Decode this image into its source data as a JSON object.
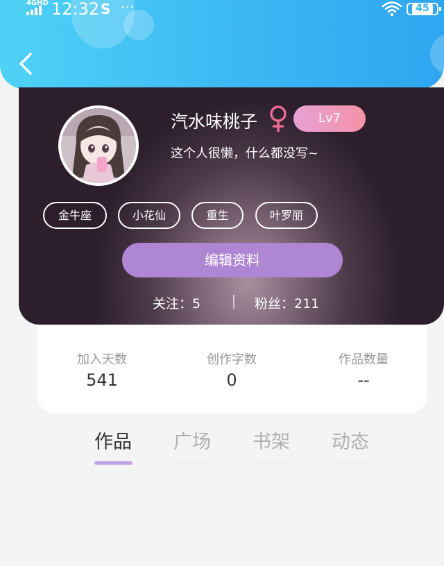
{
  "status_bar": {
    "network": "4GHD",
    "time": "12:32",
    "app_glyph": "S",
    "more": "···",
    "battery": "45"
  },
  "profile": {
    "name": "汽水味桃子",
    "gender_symbol": "♀",
    "level": "Lv7",
    "bio": "这个人很懒，什么都没写~",
    "tags": [
      "金牛座",
      "小花仙",
      "重生",
      "叶罗丽"
    ],
    "edit_label": "编辑资料",
    "following": "关注：5",
    "fans": "粉丝：211"
  },
  "stats": [
    {
      "label": "加入天数",
      "value": "541"
    },
    {
      "label": "创作字数",
      "value": "0"
    },
    {
      "label": "作品数量",
      "value": "--"
    }
  ],
  "tabs": [
    {
      "label": "作品",
      "active": true
    },
    {
      "label": "广场",
      "active": false
    },
    {
      "label": "书架",
      "active": false
    },
    {
      "label": "动态",
      "active": false
    }
  ],
  "colors": {
    "header": "#3cb7f2",
    "accent": "#ae86d4",
    "level_badge": "#f592a6",
    "gender": "#f06a96"
  },
  "icons": [
    "back-arrow-icon",
    "female-icon",
    "wifi-icon",
    "battery-icon",
    "signal-icon"
  ]
}
